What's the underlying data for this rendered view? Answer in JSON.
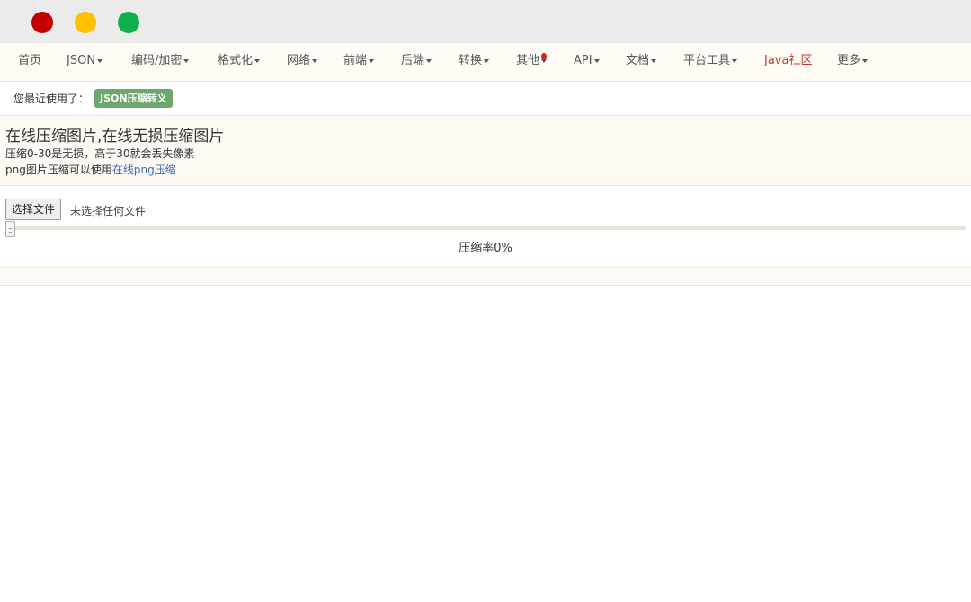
{
  "window": {
    "controls": [
      "close",
      "minimize",
      "maximize"
    ],
    "colors": {
      "close": "#c20000",
      "minimize": "#ffc000",
      "maximize": "#10b050"
    }
  },
  "nav": {
    "items": [
      {
        "label": "首页",
        "dropdown": false
      },
      {
        "label": "JSON",
        "dropdown": true
      },
      {
        "label": "编码/加密",
        "dropdown": true
      },
      {
        "label": "格式化",
        "dropdown": true
      },
      {
        "label": "网络",
        "dropdown": true
      },
      {
        "label": "前端",
        "dropdown": true
      },
      {
        "label": "后端",
        "dropdown": true
      },
      {
        "label": "转换",
        "dropdown": true
      },
      {
        "label": "其他",
        "dropdown": true,
        "icon": "balloon-icon"
      },
      {
        "label": "API",
        "dropdown": true
      },
      {
        "label": "文档",
        "dropdown": true
      },
      {
        "label": "平台工具",
        "dropdown": true
      },
      {
        "label": "Java社区",
        "dropdown": false,
        "highlight": true
      },
      {
        "label": "更多",
        "dropdown": true
      }
    ]
  },
  "recent": {
    "label": "您最近使用了：",
    "badge": "JSON压缩转义",
    "badge_color": "#6ca86c"
  },
  "intro": {
    "title": "在线压缩图片,在线无损压缩图片",
    "line1": "压缩0-30是无损，高于30就会丢失像素",
    "line2_prefix": "png图片压缩可以使用",
    "line2_link": "在线png压缩"
  },
  "upload": {
    "button_label": "选择文件",
    "status": "未选择任何文件"
  },
  "compression": {
    "slider_value": 0,
    "ratio_label": "压缩率0%"
  }
}
